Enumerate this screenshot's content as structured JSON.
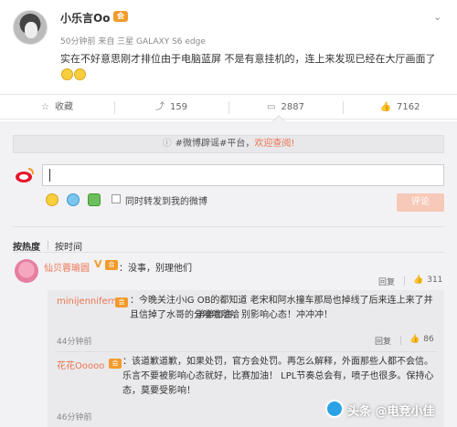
{
  "post": {
    "username": "小乐言Oo",
    "vip": "会",
    "meta": "50分钟前 来自 三星 GALAXY S6 edge",
    "content": "实在不好意思刚才排位由于电脑蓝屏 不是有意挂机的，连上来发现已经在大厅画面了"
  },
  "actions": [
    {
      "icon": "star-icon",
      "label": "收藏"
    },
    {
      "icon": "repost-icon",
      "label": "159"
    },
    {
      "icon": "comment-icon",
      "label": "2887"
    },
    {
      "icon": "thumbs-up-icon",
      "label": "7162"
    }
  ],
  "notice": {
    "prefix": "#微博辟谣#平台，",
    "link": "欢迎查阅!"
  },
  "compose": {
    "input_value": "",
    "repost_label": "同时转发到我的微博",
    "submit_label": "评论"
  },
  "sort": {
    "hot": "按热度",
    "time": "按时间"
  },
  "comments": [
    {
      "user": "仙贝蓉瑜圆",
      "text": "：没事，别理他们",
      "reply": "回复",
      "likes": "311",
      "replies": [
        {
          "user": "minijenniferm",
          "text": "：今晚关注小iG OB的都知道 老宋和阿水撞车那局也掉线了后来连上来了并且信掉了水哥的分哈哈哈哈",
          "text2": "弟弟加油，别影响心态！冲冲冲！",
          "time": "44分钟前",
          "reply": "回复",
          "likes": "86"
        },
        {
          "user": "花花Ooooo",
          "text": "：该道歉道歉，如果处罚，官方会处罚。再怎么解释，外面那些人都不会信。乐言不要被影响心态就好，比赛加油！ LPL节奏总会有，喷子也很多。保持心态，莫要受影响！",
          "time": "46分钟前"
        }
      ]
    }
  ],
  "watermark": "头条 @电竞小佳",
  "colors": {
    "accent": "#eb7350",
    "vip": "#f29b2b",
    "submit": "#f7c9b8"
  }
}
